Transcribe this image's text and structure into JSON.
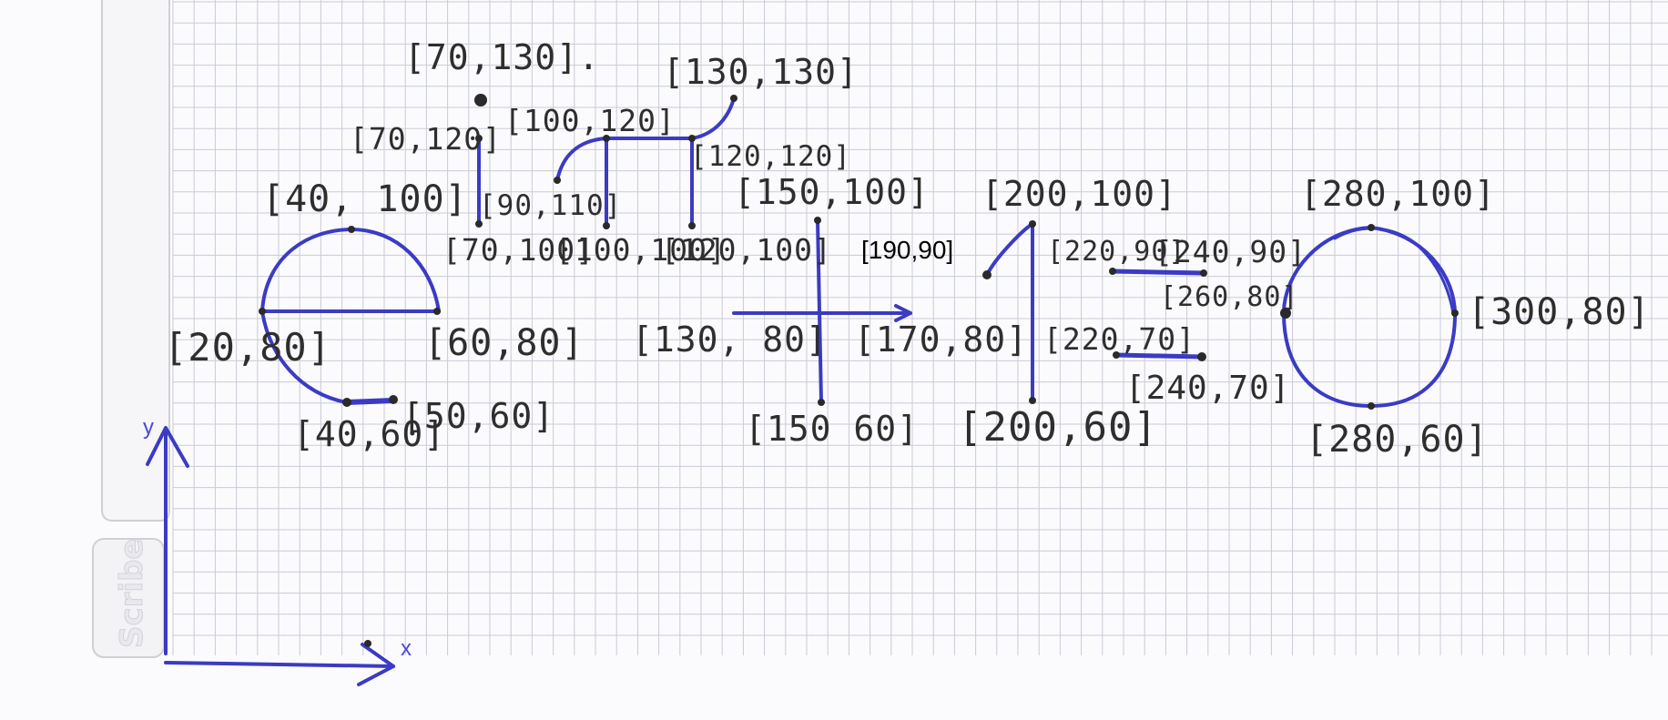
{
  "sidebar": {
    "tab_label": "Scribe"
  },
  "axes": {
    "x_label": "x",
    "y_label": "y"
  },
  "labels": {
    "p70_130": "[70,130].",
    "p130_130": "[130,130]",
    "p70_120": "[70,120]",
    "p100_120": "[100,120]",
    "p120_120": "[120,120]",
    "p90_110": "[90,110]",
    "p40_100": "[40, 100]",
    "p70_100": "[70,100]",
    "p100_100": "[100,100]",
    "p120_100": "[120,100]",
    "p150_100": "[150,100]",
    "p190_90": "[190,90]",
    "p200_100": "[200,100]",
    "p220_90": "[220,90]",
    "p240_90": "[240,90]",
    "p260_80": "[260,80]",
    "p280_100": "[280,100]",
    "p20_80": "[20,80]",
    "p60_80": "[60,80]",
    "p130_80": "[130, 80]",
    "p170_80": "[170,80]",
    "p220_70": "[220,70]",
    "p240_70": "[240,70]",
    "p300_80": "[300,80]",
    "p40_60": "[40,60]",
    "p50_60": "[50,60]",
    "p150_60": "[150 60]",
    "p200_60": "[200,60]",
    "p280_60": "[280,60]"
  },
  "colors": {
    "ink": "#3b3bc4",
    "grid": "#c9cbd6",
    "paper": "#fbfbfd",
    "label": "#2e2e2e"
  }
}
